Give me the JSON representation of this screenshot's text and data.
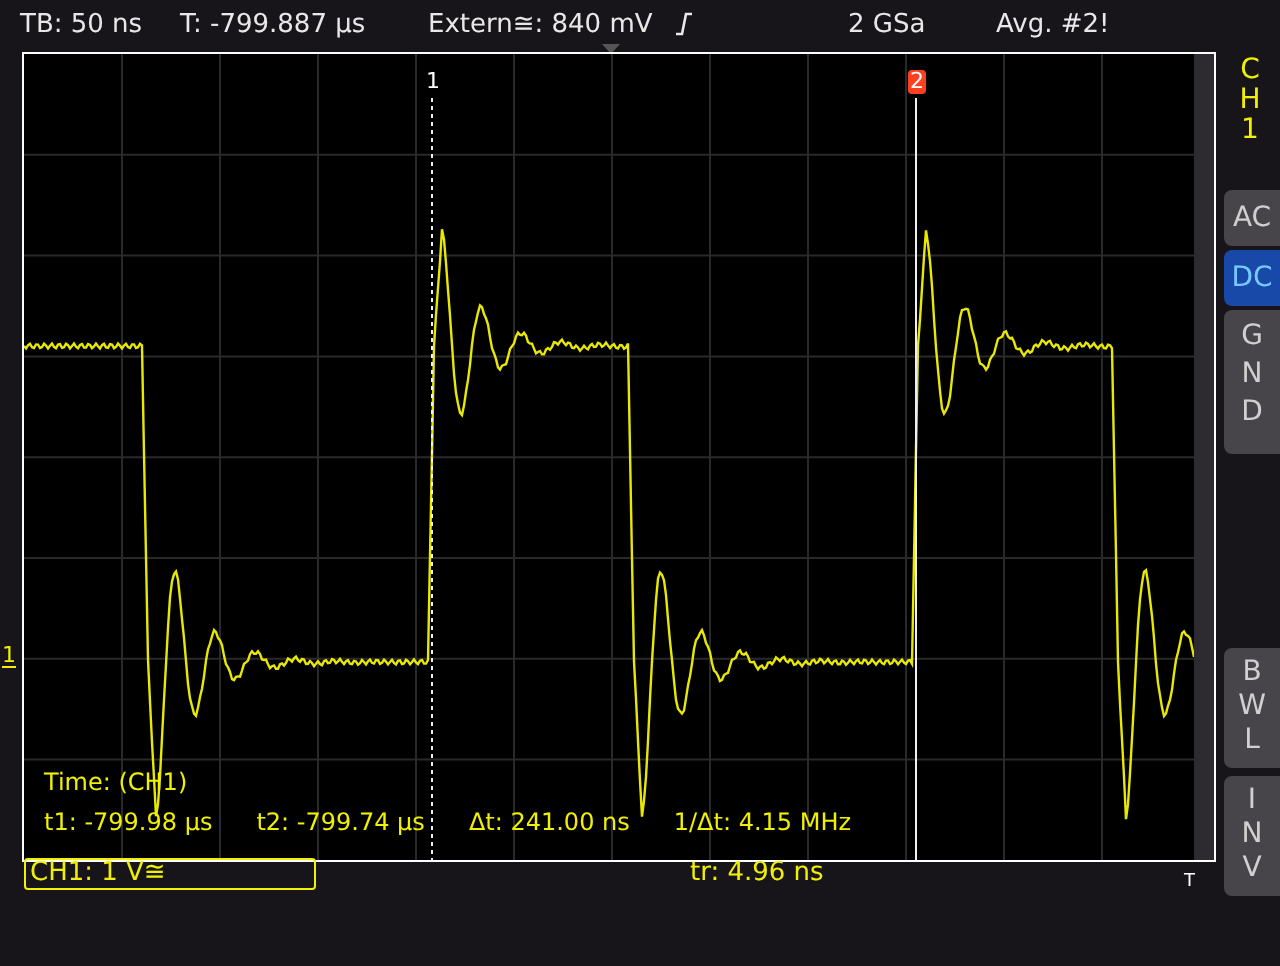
{
  "status_bar": {
    "timebase": "TB: 50 ns",
    "trigger_time": "T: -799.887 µs",
    "trigger_source": "Extern≅: 840 mV",
    "sample_rate": "2 GSa",
    "acquisition": "Avg. #2!"
  },
  "channel_label": "CH1",
  "coupling_buttons": [
    {
      "label": "AC",
      "selected": false
    },
    {
      "label": "DC",
      "selected": true
    },
    {
      "label": "GND",
      "selected": false
    }
  ],
  "option_buttons": [
    {
      "label": "BWL",
      "on": false
    },
    {
      "label": "INV",
      "on": false
    }
  ],
  "cursors": [
    {
      "label": "1",
      "kind": "dotted"
    },
    {
      "label": "2",
      "kind": "solid"
    }
  ],
  "ground_marker": "1",
  "trigger_marker": "T",
  "measurements": {
    "title": "Time: (CH1)",
    "values": [
      "t1: -799.98 µs",
      "t2: -799.74 µs",
      "Δt: 241.00 ns",
      "1/Δt: 4.15 MHz"
    ]
  },
  "channel_setting": "CH1: 1 V≅",
  "rise_time": "tr: 4.96 ns"
}
